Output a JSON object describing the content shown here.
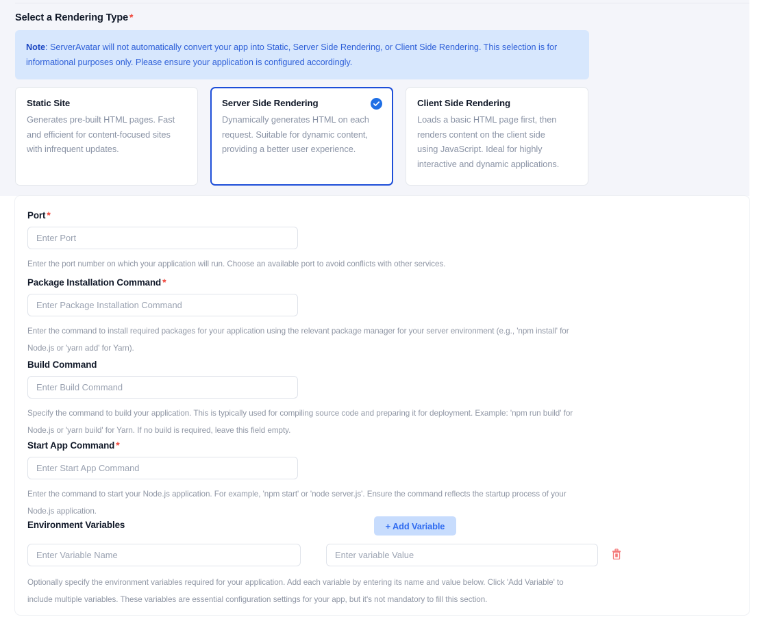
{
  "section": {
    "title": "Select a Rendering Type",
    "required_mark": "*"
  },
  "note": {
    "label": "Note",
    "body": ": ServerAvatar will not automatically convert your app into Static, Server Side Rendering, or Client Side Rendering. This selection is for informational purposes only. Please ensure your application is configured accordingly.",
    "background_color": "#d7e7fd",
    "text_color": "#2d5fd8"
  },
  "rendering_types": [
    {
      "title": "Static Site",
      "description": "Generates pre-built HTML pages. Fast and efficient for content-focused sites with infrequent updates.",
      "selected": false
    },
    {
      "title": "Server Side Rendering",
      "description": "Dynamically generates HTML on each request. Suitable for dynamic content, providing a better user experience.",
      "selected": true
    },
    {
      "title": "Client Side Rendering",
      "description": "Loads a basic HTML page first, then renders content on the client side using JavaScript. Ideal for highly interactive and dynamic applications.",
      "selected": false
    }
  ],
  "selected_accent_color": "#1d4ed8",
  "fields": {
    "port": {
      "label": "Port",
      "required_mark": "*",
      "value": "",
      "placeholder": "Enter Port",
      "help": "Enter the port number on which your application will run. Choose an available port to avoid conflicts with other services."
    },
    "package_install": {
      "label": "Package Installation Command",
      "required_mark": "*",
      "value": "",
      "placeholder": "Enter Package Installation Command",
      "help": "Enter the command to install required packages for your application using the relevant package manager for your server environment (e.g., 'npm install' for Node.js or 'yarn add' for Yarn)."
    },
    "build_command": {
      "label": "Build Command",
      "required_mark": "",
      "value": "",
      "placeholder": "Enter Build Command",
      "help": "Specify the command to build your application. This is typically used for compiling source code and preparing it for deployment. Example: 'npm run build' for Node.js or 'yarn build' for Yarn. If no build is required, leave this field empty."
    },
    "start_app_command": {
      "label": "Start App Command",
      "required_mark": "*",
      "value": "",
      "placeholder": "Enter Start App Command",
      "help": "Enter the command to start your Node.js application. For example, 'npm start' or 'node server.js'. Ensure the command reflects the startup process of your Node.js application."
    }
  },
  "environment_variables": {
    "label": "Environment Variables",
    "add_button_label": "+ Add Variable",
    "add_button_background": "#c7dcfd",
    "add_button_text_color": "#2f6bf0",
    "rows": [
      {
        "name_value": "",
        "name_placeholder": "Enter Variable Name",
        "value_value": "",
        "value_placeholder": "Enter variable Value",
        "delete_icon": "trash-icon"
      }
    ],
    "help": "Optionally specify the environment variables required for your application. Add each variable by entering its name and value below. Click 'Add Variable' to include multiple variables. These variables are essential configuration settings for your app, but it's not mandatory to fill this section.",
    "delete_icon_color": "#f47a7a"
  }
}
